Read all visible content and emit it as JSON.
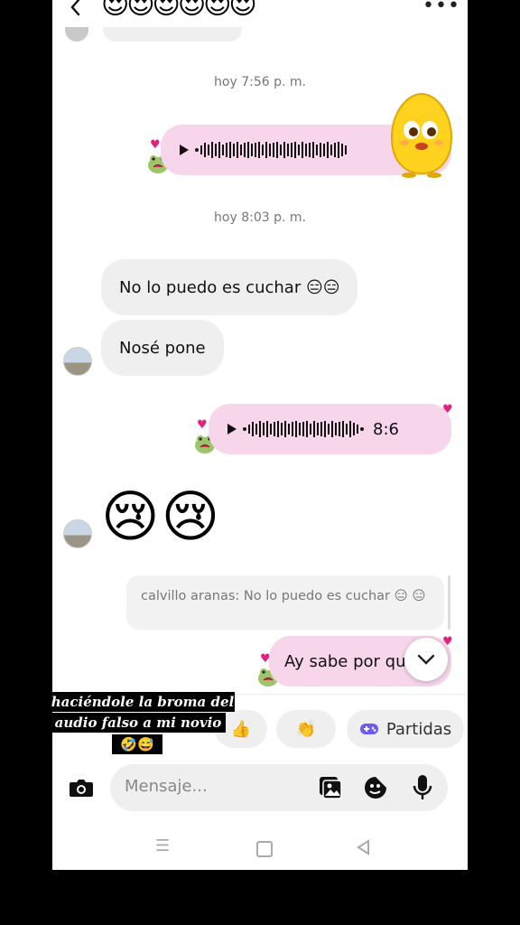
{
  "header": {
    "emojis": "😍😍😍😍😍😍"
  },
  "timestamps": [
    "hoy 7:56 p. m.",
    "hoy 8:03 p. m."
  ],
  "messages": {
    "incoming_1": "No lo puedo es cuchar 😑😑",
    "incoming_2": "Nosé pone",
    "voice_duration": "8:6",
    "crying_emojis": "😢😢",
    "reply_quote": "calvillo aranas: No lo puedo es cuchar 😑 😑",
    "outgoing_text": "Ay sabe por qu"
  },
  "quick_replies": [
    "👍",
    "👏",
    "Partidas"
  ],
  "caption": {
    "line1": "haciéndole la broma del",
    "line2": "audio falso a mi novio",
    "line3": "🤣😅"
  },
  "composer": {
    "placeholder": "Mensaje..."
  },
  "colors": {
    "outgoing_bubble": "#f7d6ec",
    "incoming_bubble": "#efefef",
    "heart": "#e3207e",
    "games_icon": "#6b5cf0"
  }
}
